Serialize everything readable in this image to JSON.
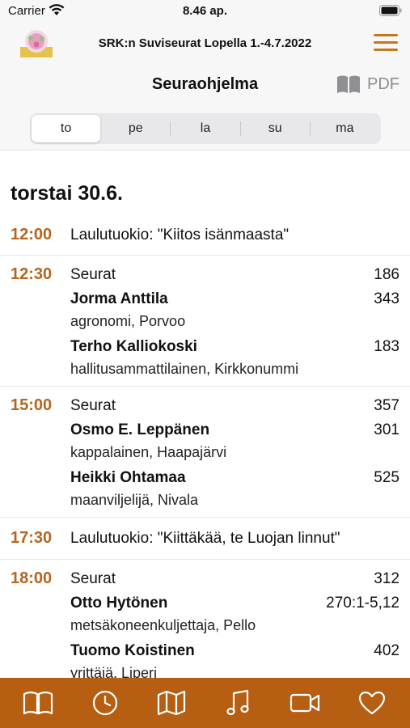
{
  "status_bar": {
    "carrier": "Carrier",
    "time": "8.46 ap."
  },
  "header": {
    "title": "SRK:n Suviseurat Lopella 1.-4.7.2022",
    "page_title": "Seuraohjelma",
    "pdf_label": "PDF"
  },
  "day_tabs": [
    {
      "label": "to",
      "selected": true
    },
    {
      "label": "pe",
      "selected": false
    },
    {
      "label": "la",
      "selected": false
    },
    {
      "label": "su",
      "selected": false
    },
    {
      "label": "ma",
      "selected": false
    }
  ],
  "schedule": {
    "day_heading": "torstai 30.6.",
    "events": [
      {
        "time": "12:00",
        "title": "Laulutuokio: \"Kiitos isänmaasta\"",
        "number": ""
      },
      {
        "time": "12:30",
        "title": "Seurat",
        "number": "186",
        "speakers": [
          {
            "name": "Jorma Anttila",
            "role": "agronomi, Porvoo",
            "number": "343"
          },
          {
            "name": "Terho Kalliokoski",
            "role": "hallitusammattilainen, Kirkkonummi",
            "number": "183"
          }
        ]
      },
      {
        "time": "15:00",
        "title": "Seurat",
        "number": "357",
        "speakers": [
          {
            "name": "Osmo E. Leppänen",
            "role": "kappalainen, Haapajärvi",
            "number": "301"
          },
          {
            "name": "Heikki Ohtamaa",
            "role": "maanviljelijä, Nivala",
            "number": "525"
          }
        ]
      },
      {
        "time": "17:30",
        "title": "Laulutuokio: \"Kiittäkää, te Luojan linnut\"",
        "number": ""
      },
      {
        "time": "18:00",
        "title": "Seurat",
        "number": "312",
        "speakers": [
          {
            "name": "Otto Hytönen",
            "role": "metsäkoneenkuljettaja, Pello",
            "number": "270:1-5,12"
          },
          {
            "name": "Tuomo Koistinen",
            "role": "yrittäjä, Liperi",
            "number": "402"
          }
        ]
      }
    ]
  },
  "tab_bar": {
    "items": [
      "book-icon",
      "clock-icon",
      "map-icon",
      "music-note-icon",
      "video-camera-icon",
      "heart-icon"
    ]
  },
  "colors": {
    "accent": "#b65e12",
    "time_text": "#b5651d",
    "background": "#ffffff",
    "header_background": "#f7f7f7"
  }
}
